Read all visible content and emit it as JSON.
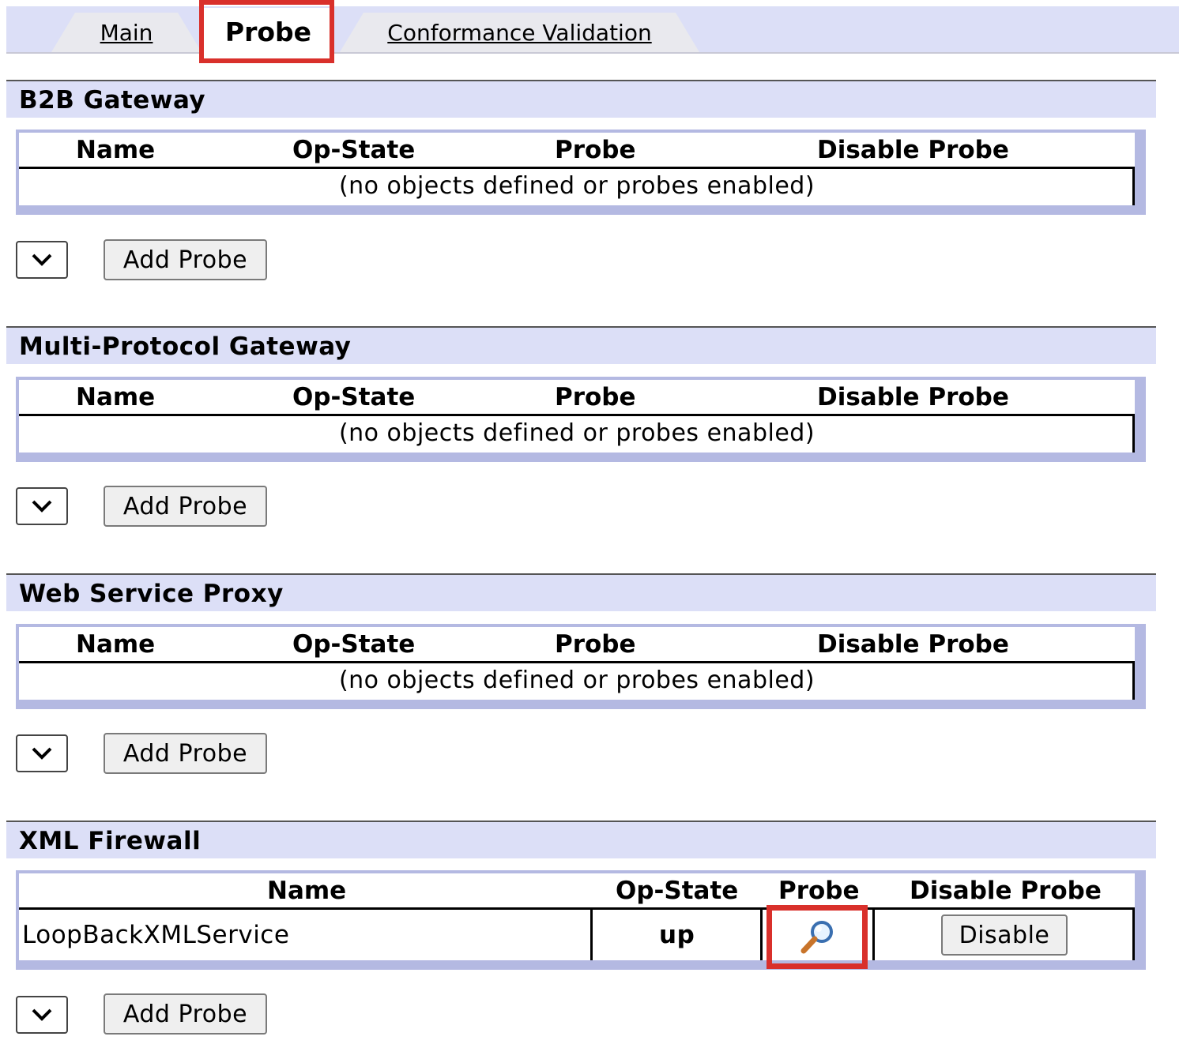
{
  "tabs": [
    {
      "label": "Main",
      "active": false
    },
    {
      "label": "Probe",
      "active": true
    },
    {
      "label": "Conformance Validation",
      "active": false
    }
  ],
  "columns": {
    "name": "Name",
    "op_state": "Op-State",
    "probe": "Probe",
    "disable_probe": "Disable Probe"
  },
  "sections": [
    {
      "title": "B2B Gateway",
      "empty_message": "(no objects defined or probes enabled)",
      "add_label": "Add Probe"
    },
    {
      "title": "Multi-Protocol Gateway",
      "empty_message": "(no objects defined or probes enabled)",
      "add_label": "Add Probe"
    },
    {
      "title": "Web Service Proxy",
      "empty_message": "(no objects defined or probes enabled)",
      "add_label": "Add Probe"
    },
    {
      "title": "XML Firewall",
      "add_label": "Add Probe",
      "rows": [
        {
          "name": "LoopBackXMLService",
          "op_state": "up",
          "probe_icon": "magnifier-icon",
          "disable_label": "Disable"
        }
      ]
    }
  ],
  "colors": {
    "header_bg": "#dcdff7",
    "grid_border": "#b4b9e2",
    "highlight": "#d9302b"
  }
}
